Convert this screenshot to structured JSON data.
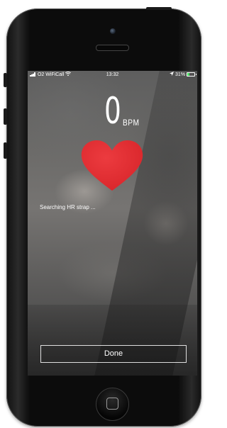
{
  "status_bar": {
    "carrier": "O2 WiFiCall",
    "time": "13:32",
    "battery_percent": "31%",
    "battery_level": 0.31
  },
  "hr": {
    "value": "0",
    "unit": "BPM",
    "heart_color": "#d9262b"
  },
  "message": "Searching HR strap ...",
  "done_label": "Done"
}
